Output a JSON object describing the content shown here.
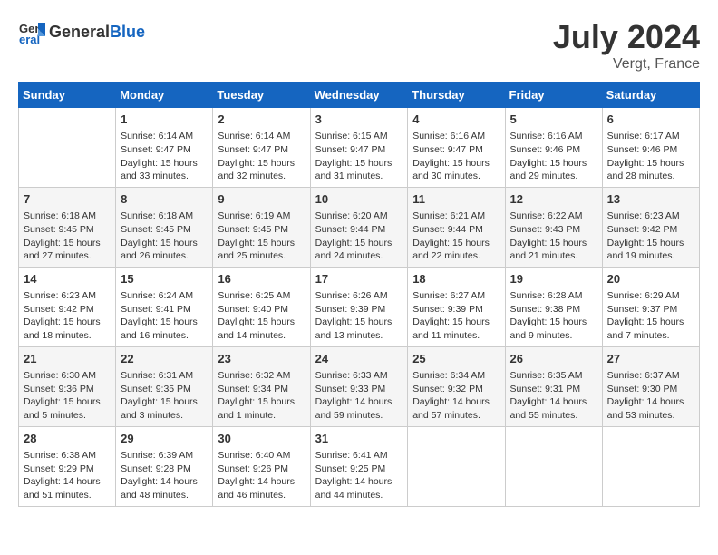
{
  "header": {
    "logo_general": "General",
    "logo_blue": "Blue",
    "month_year": "July 2024",
    "location": "Vergt, France"
  },
  "weekdays": [
    "Sunday",
    "Monday",
    "Tuesday",
    "Wednesday",
    "Thursday",
    "Friday",
    "Saturday"
  ],
  "rows": [
    [
      {
        "day": "",
        "content": ""
      },
      {
        "day": "1",
        "content": "Sunrise: 6:14 AM\nSunset: 9:47 PM\nDaylight: 15 hours\nand 33 minutes."
      },
      {
        "day": "2",
        "content": "Sunrise: 6:14 AM\nSunset: 9:47 PM\nDaylight: 15 hours\nand 32 minutes."
      },
      {
        "day": "3",
        "content": "Sunrise: 6:15 AM\nSunset: 9:47 PM\nDaylight: 15 hours\nand 31 minutes."
      },
      {
        "day": "4",
        "content": "Sunrise: 6:16 AM\nSunset: 9:47 PM\nDaylight: 15 hours\nand 30 minutes."
      },
      {
        "day": "5",
        "content": "Sunrise: 6:16 AM\nSunset: 9:46 PM\nDaylight: 15 hours\nand 29 minutes."
      },
      {
        "day": "6",
        "content": "Sunrise: 6:17 AM\nSunset: 9:46 PM\nDaylight: 15 hours\nand 28 minutes."
      }
    ],
    [
      {
        "day": "7",
        "content": "Sunrise: 6:18 AM\nSunset: 9:45 PM\nDaylight: 15 hours\nand 27 minutes."
      },
      {
        "day": "8",
        "content": "Sunrise: 6:18 AM\nSunset: 9:45 PM\nDaylight: 15 hours\nand 26 minutes."
      },
      {
        "day": "9",
        "content": "Sunrise: 6:19 AM\nSunset: 9:45 PM\nDaylight: 15 hours\nand 25 minutes."
      },
      {
        "day": "10",
        "content": "Sunrise: 6:20 AM\nSunset: 9:44 PM\nDaylight: 15 hours\nand 24 minutes."
      },
      {
        "day": "11",
        "content": "Sunrise: 6:21 AM\nSunset: 9:44 PM\nDaylight: 15 hours\nand 22 minutes."
      },
      {
        "day": "12",
        "content": "Sunrise: 6:22 AM\nSunset: 9:43 PM\nDaylight: 15 hours\nand 21 minutes."
      },
      {
        "day": "13",
        "content": "Sunrise: 6:23 AM\nSunset: 9:42 PM\nDaylight: 15 hours\nand 19 minutes."
      }
    ],
    [
      {
        "day": "14",
        "content": "Sunrise: 6:23 AM\nSunset: 9:42 PM\nDaylight: 15 hours\nand 18 minutes."
      },
      {
        "day": "15",
        "content": "Sunrise: 6:24 AM\nSunset: 9:41 PM\nDaylight: 15 hours\nand 16 minutes."
      },
      {
        "day": "16",
        "content": "Sunrise: 6:25 AM\nSunset: 9:40 PM\nDaylight: 15 hours\nand 14 minutes."
      },
      {
        "day": "17",
        "content": "Sunrise: 6:26 AM\nSunset: 9:39 PM\nDaylight: 15 hours\nand 13 minutes."
      },
      {
        "day": "18",
        "content": "Sunrise: 6:27 AM\nSunset: 9:39 PM\nDaylight: 15 hours\nand 11 minutes."
      },
      {
        "day": "19",
        "content": "Sunrise: 6:28 AM\nSunset: 9:38 PM\nDaylight: 15 hours\nand 9 minutes."
      },
      {
        "day": "20",
        "content": "Sunrise: 6:29 AM\nSunset: 9:37 PM\nDaylight: 15 hours\nand 7 minutes."
      }
    ],
    [
      {
        "day": "21",
        "content": "Sunrise: 6:30 AM\nSunset: 9:36 PM\nDaylight: 15 hours\nand 5 minutes."
      },
      {
        "day": "22",
        "content": "Sunrise: 6:31 AM\nSunset: 9:35 PM\nDaylight: 15 hours\nand 3 minutes."
      },
      {
        "day": "23",
        "content": "Sunrise: 6:32 AM\nSunset: 9:34 PM\nDaylight: 15 hours\nand 1 minute."
      },
      {
        "day": "24",
        "content": "Sunrise: 6:33 AM\nSunset: 9:33 PM\nDaylight: 14 hours\nand 59 minutes."
      },
      {
        "day": "25",
        "content": "Sunrise: 6:34 AM\nSunset: 9:32 PM\nDaylight: 14 hours\nand 57 minutes."
      },
      {
        "day": "26",
        "content": "Sunrise: 6:35 AM\nSunset: 9:31 PM\nDaylight: 14 hours\nand 55 minutes."
      },
      {
        "day": "27",
        "content": "Sunrise: 6:37 AM\nSunset: 9:30 PM\nDaylight: 14 hours\nand 53 minutes."
      }
    ],
    [
      {
        "day": "28",
        "content": "Sunrise: 6:38 AM\nSunset: 9:29 PM\nDaylight: 14 hours\nand 51 minutes."
      },
      {
        "day": "29",
        "content": "Sunrise: 6:39 AM\nSunset: 9:28 PM\nDaylight: 14 hours\nand 48 minutes."
      },
      {
        "day": "30",
        "content": "Sunrise: 6:40 AM\nSunset: 9:26 PM\nDaylight: 14 hours\nand 46 minutes."
      },
      {
        "day": "31",
        "content": "Sunrise: 6:41 AM\nSunset: 9:25 PM\nDaylight: 14 hours\nand 44 minutes."
      },
      {
        "day": "",
        "content": ""
      },
      {
        "day": "",
        "content": ""
      },
      {
        "day": "",
        "content": ""
      }
    ]
  ]
}
